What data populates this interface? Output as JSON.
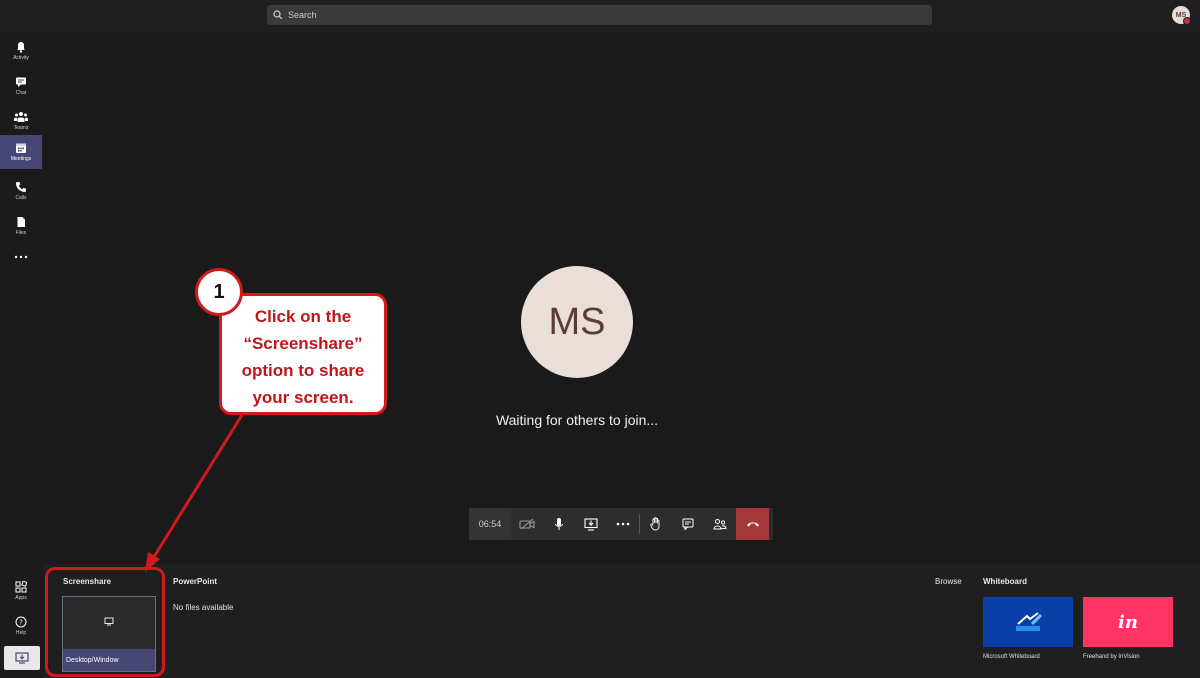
{
  "search": {
    "placeholder": "Search"
  },
  "user": {
    "initials": "MS"
  },
  "rail": {
    "items": [
      {
        "label": "Activity",
        "icon": "bell-icon"
      },
      {
        "label": "Chat",
        "icon": "chat-icon"
      },
      {
        "label": "Teams",
        "icon": "teams-icon"
      },
      {
        "label": "Meetings",
        "icon": "calendar-icon"
      },
      {
        "label": "Calls",
        "icon": "phone-icon"
      },
      {
        "label": "Files",
        "icon": "file-icon"
      },
      {
        "label": "Apps",
        "icon": "apps-icon"
      },
      {
        "label": "Help",
        "icon": "help-icon"
      }
    ],
    "active": "Meetings"
  },
  "meeting": {
    "participant_initials": "MS",
    "status": "Waiting for others to join...",
    "timer": "06:54"
  },
  "share_tray": {
    "screenshare_title": "Screenshare",
    "screenshare_tile": "Desktop/Window",
    "powerpoint_title": "PowerPoint",
    "powerpoint_empty": "No files available",
    "browse": "Browse",
    "whiteboard_title": "Whiteboard",
    "whiteboard_options": [
      {
        "label": "Microsoft Whiteboard",
        "color": "#0a3fa8"
      },
      {
        "label": "Freehand by InVision",
        "color": "#ff3366",
        "mark": "in"
      }
    ]
  },
  "annotation": {
    "step": "1",
    "text_lines": [
      "Click on the",
      "“Screenshare”",
      "option to share",
      "your screen."
    ]
  },
  "colors": {
    "accent": "#464775",
    "hangup": "#a4373a",
    "callout_red": "#d11a1a"
  }
}
